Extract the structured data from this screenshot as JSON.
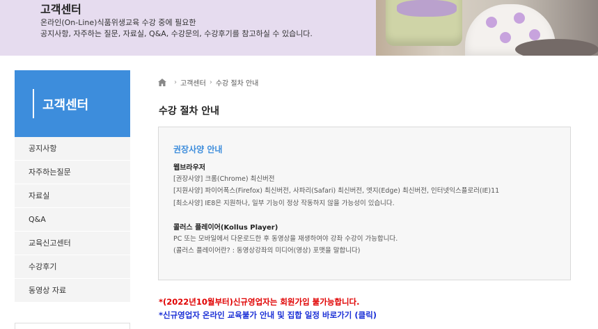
{
  "banner": {
    "title": "고객센터",
    "desc_line1": "온라인(On-Line)식품위생교육 수강 중에 필요한",
    "desc_line2": "공지사항, 자주하는 질문, 자료실, Q&A, 수강문의, 수강후기를 참고하실 수 있습니다."
  },
  "sidebar": {
    "title": "고객센터",
    "items": [
      {
        "label": "공지사항"
      },
      {
        "label": "자주하는질문"
      },
      {
        "label": "자료실"
      },
      {
        "label": "Q&A"
      },
      {
        "label": "교육신고센터"
      },
      {
        "label": "수강후기"
      },
      {
        "label": "동영상 자료"
      }
    ]
  },
  "breadcrumb": {
    "icon": "home-icon",
    "items": [
      "고객센터",
      "수강 절차 안내"
    ]
  },
  "page_title": "수강 절차 안내",
  "info": {
    "title": "권장사양 안내",
    "browser_title": "웹브라우저",
    "browser_lines": [
      "[권장사양] 크롬(Chrome) 최신버전",
      "[지원사양] 파이어폭스(Firefox) 최신버전, 사파리(Safari) 최신버전, 엣지(Edge) 최신버전, 인터넷익스플로러(IE)11",
      "[최소사양] IE8은 지원하나, 일부 기능이 정상 작동하지 않을 가능성이 있습니다."
    ],
    "player_title": "콜러스 플레이어(Kollus Player)",
    "player_lines": [
      "PC 또는 모바일에서 다운로드한 후 동영상을 재생하여야 강좌 수강이 가능합니다.",
      "(콜러스 플레이어란? : 동영상강좌의 미디어(영상) 포맷을 말합니다)"
    ]
  },
  "notices": {
    "red": "*(2022년10월부터)신규영업자는 회원가입 불가능합니다.",
    "blue": "*신규영업자 온라인 교육불가 안내 및 집합 일정 바로가기 (클릭)"
  },
  "colors": {
    "banner_bg": "#e6dcef",
    "sidebar_accent": "#3d8ddc",
    "notice_red": "#e00000",
    "notice_blue": "#1a2fd6"
  }
}
